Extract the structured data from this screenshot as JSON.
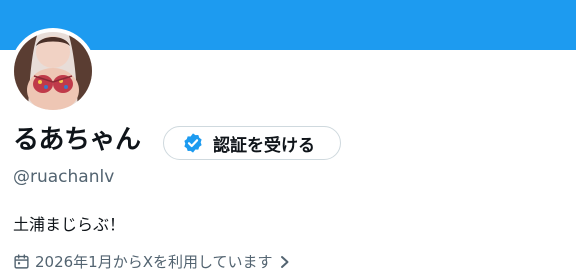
{
  "profile": {
    "display_name": "るあちゃん",
    "verify_button_label": "認証を受ける",
    "handle": "@ruachanlv",
    "bio": "土浦まじらぶ！",
    "joined_text": "2026年1月からXを利用しています"
  },
  "colors": {
    "banner": "#1d9bf0",
    "verified_badge": "#1d9bf0",
    "secondary_text": "#536471",
    "primary_text": "#0f1419"
  },
  "icons": {
    "verify": "verified-badge-icon",
    "joined": "calendar-icon",
    "more": "chevron-right-icon"
  }
}
